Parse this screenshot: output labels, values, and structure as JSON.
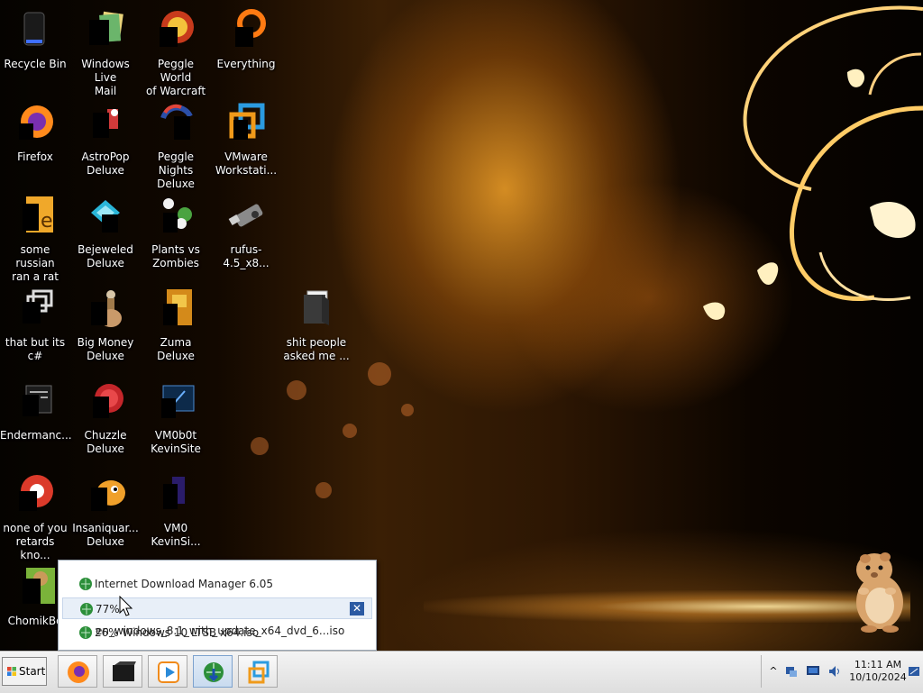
{
  "desktop": {
    "icons": [
      {
        "label": "Recycle Bin",
        "icon": "recycle-bin-icon"
      },
      {
        "label": "Windows Live\nMail",
        "icon": "windows-live-mail-icon"
      },
      {
        "label": "Peggle World\nof Warcraft ...",
        "icon": "peggle-icon"
      },
      {
        "label": "Everything",
        "icon": "everything-search-icon"
      },
      {
        "label": "Firefox",
        "icon": "firefox-icon"
      },
      {
        "label": "AstroPop\nDeluxe",
        "icon": "astropop-icon"
      },
      {
        "label": "Peggle Nights\nDeluxe",
        "icon": "peggle-nights-icon"
      },
      {
        "label": "VMware\nWorkstati...",
        "icon": "vmware-icon"
      },
      {
        "label": "some russian\nran a rat",
        "icon": "shortcut-icon"
      },
      {
        "label": "Bejeweled\nDeluxe",
        "icon": "bejeweled-icon"
      },
      {
        "label": "Plants vs\nZombies",
        "icon": "plants-vs-zombies-icon"
      },
      {
        "label": "rufus-4.5_x8...",
        "icon": "usb-drive-icon"
      },
      {
        "label": "that but its c#",
        "icon": "shortcut-icon"
      },
      {
        "label": "Big Money\nDeluxe",
        "icon": "big-money-icon"
      },
      {
        "label": "Zuma Deluxe",
        "icon": "zuma-icon"
      },
      {
        "label": "shit people\nasked me ...",
        "icon": "folder-icon"
      },
      {
        "label": "Endermanc...",
        "icon": "app-window-icon"
      },
      {
        "label": "Chuzzle\nDeluxe",
        "icon": "chuzzle-icon"
      },
      {
        "label": "VM0b0t\nKevinSite",
        "icon": "app-window-icon"
      },
      {
        "label": "none of you\nretards kno...",
        "icon": "chrome-icon"
      },
      {
        "label": "Insaniquar...\nDeluxe",
        "icon": "insaniquarium-icon"
      },
      {
        "label": "VM0\nKevinSi...",
        "icon": "app-window-icon"
      },
      {
        "label": "ChomikBo",
        "icon": "chomik-icon"
      }
    ]
  },
  "idm_popup": {
    "title": "Internet Download Manager 6.05",
    "downloads": [
      {
        "label": "77% en_windows_8.1_with_update_x64_dvd_6...iso",
        "progress_percent": 77
      },
      {
        "label": "26% Windows 10 LTSB x64.iso",
        "progress_percent": 26
      }
    ],
    "close_glyph": "✕",
    "accent_color": "#2b5aa3"
  },
  "taskbar": {
    "start_label": "Start",
    "pinned": [
      {
        "icon": "firefox-icon"
      },
      {
        "icon": "terminal-icon"
      },
      {
        "icon": "media-player-icon"
      },
      {
        "icon": "internet-download-manager-icon",
        "active": true
      },
      {
        "icon": "vmware-icon"
      }
    ],
    "tray": {
      "icons": [
        "show-hidden-chevron-icon",
        "network-icon",
        "monitor-icon",
        "volume-icon"
      ],
      "time": "11:11 AM",
      "date": "10/10/2024"
    }
  }
}
